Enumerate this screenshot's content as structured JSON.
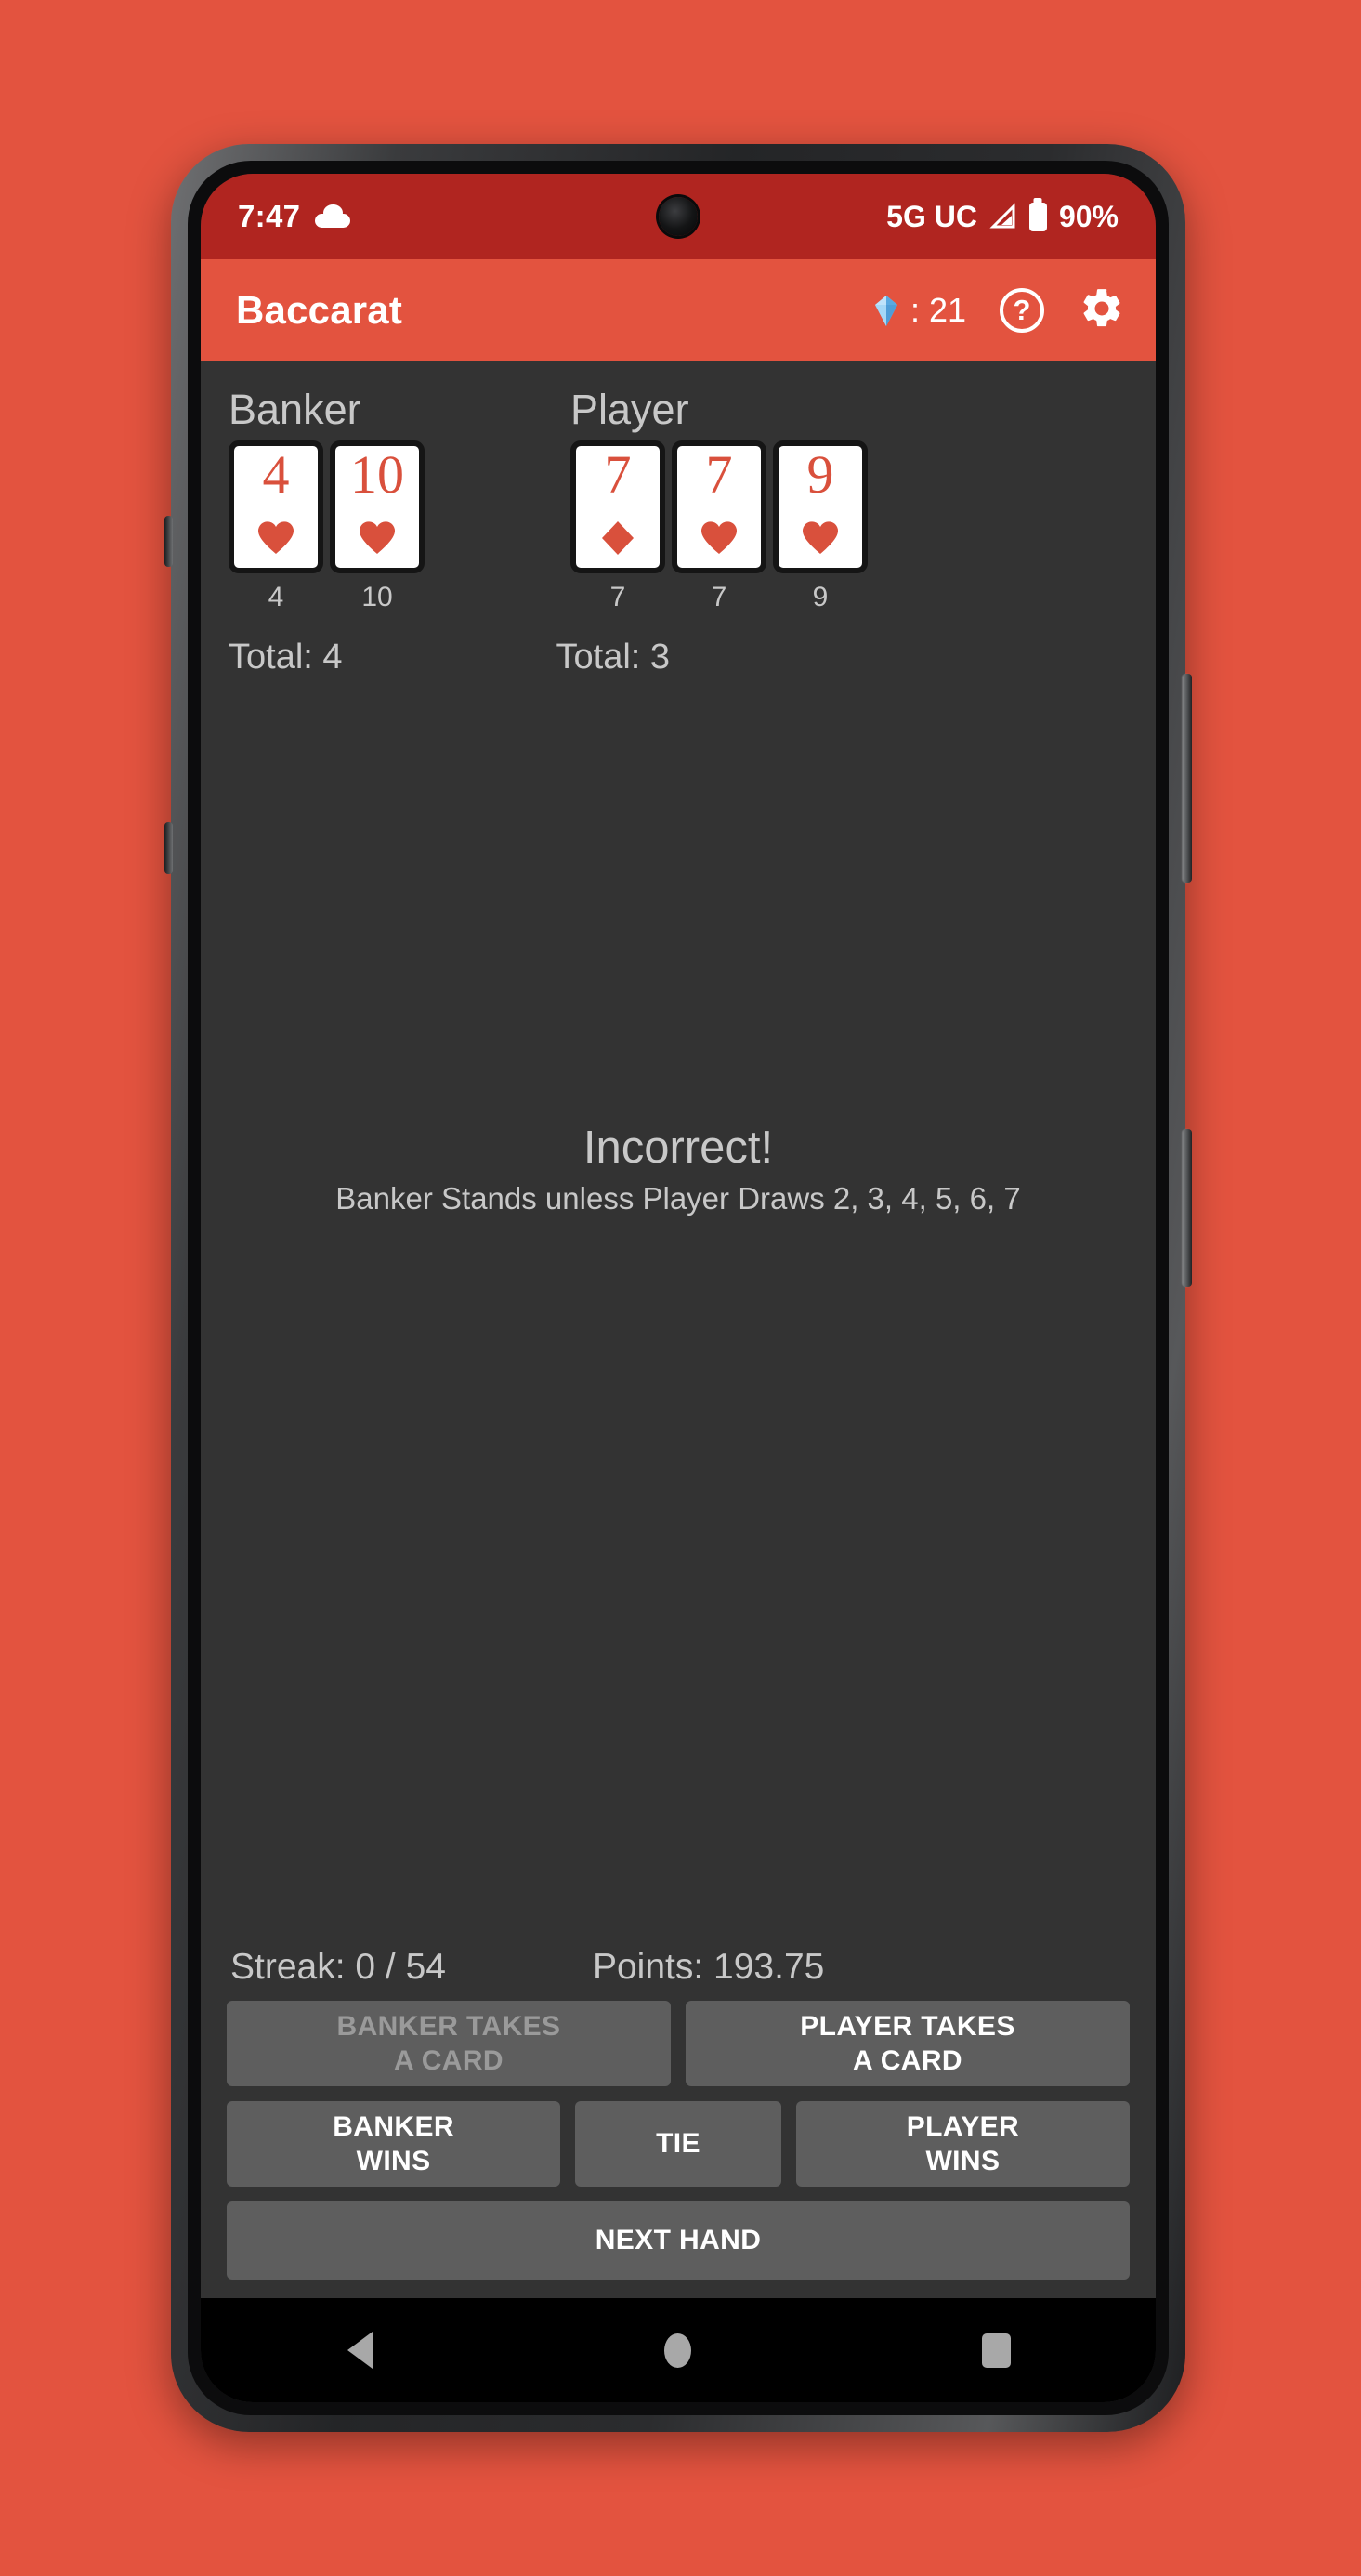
{
  "status_bar": {
    "time": "7:47",
    "weather_icon": "cloud-icon",
    "network": "5G UC",
    "battery": "90%"
  },
  "app_bar": {
    "title": "Baccarat",
    "gem_icon": "diamond-gem-icon",
    "gem_count": ": 21",
    "help_icon": "?",
    "settings_icon": "gear-icon"
  },
  "game": {
    "banker": {
      "label": "Banker",
      "total": "Total: 4",
      "cards": [
        {
          "rank": "4",
          "suit": "heart",
          "value": "4"
        },
        {
          "rank": "10",
          "suit": "heart",
          "value": "10"
        }
      ]
    },
    "player": {
      "label": "Player",
      "total": "Total: 3",
      "cards": [
        {
          "rank": "7",
          "suit": "diamond",
          "value": "7"
        },
        {
          "rank": "7",
          "suit": "heart",
          "value": "7"
        },
        {
          "rank": "9",
          "suit": "heart",
          "value": "9"
        }
      ]
    },
    "feedback": {
      "title": "Incorrect!",
      "detail": "Banker Stands unless Player Draws 2, 3, 4, 5, 6, 7"
    },
    "stats": {
      "streak": "Streak: 0 / 54",
      "points": "Points: 193.75"
    }
  },
  "actions": {
    "banker_takes_card": "BANKER TAKES\nA CARD",
    "player_takes_card": "PLAYER TAKES\nA CARD",
    "banker_wins": "BANKER\nWINS",
    "tie": "TIE",
    "player_wins": "PLAYER\nWINS",
    "next_hand": "NEXT HAND"
  },
  "nav_bar": {
    "back": "back-icon",
    "home": "home-icon",
    "recents": "recents-icon"
  },
  "colors": {
    "brand_red": "#e3533f",
    "status_red": "#b02520",
    "screen_bg": "#333333",
    "button_gray": "#5e5e5e",
    "card_red": "#d9503c",
    "text_gray": "#c8c8c8"
  }
}
